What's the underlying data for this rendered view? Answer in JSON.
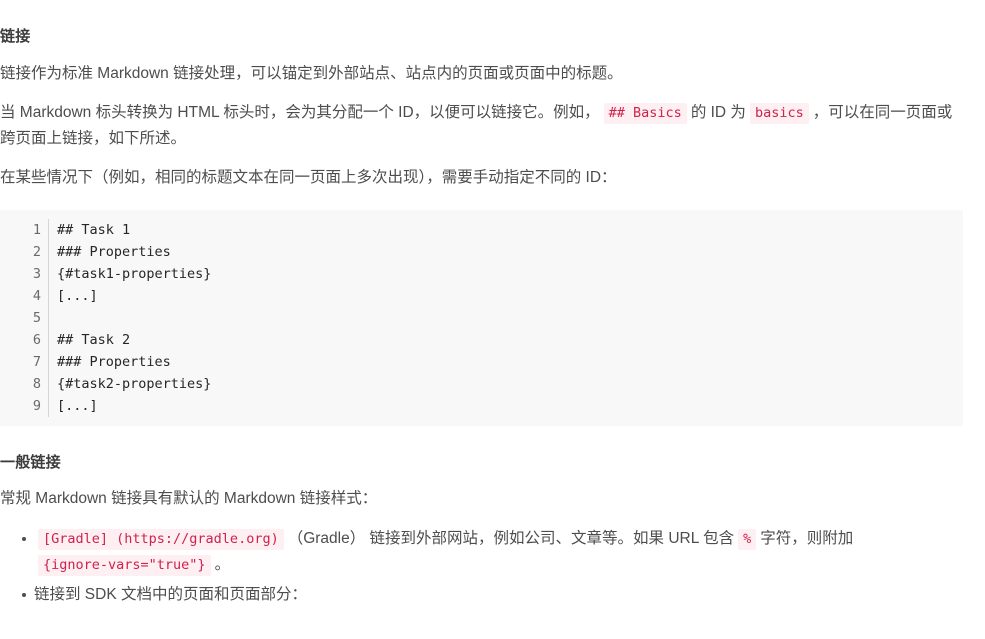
{
  "document": {
    "heading": "链接",
    "paragraphs": {
      "p1": "链接作为标准 Markdown 链接处理，可以锚定到外部站点、站点内的页面或页面中的标题。",
      "p2_part1": "当 Markdown 标头转换为 HTML 标头时，会为其分配一个 ID，以便可以链接它。例如，",
      "p2_code1": "## Basics",
      "p2_part2": "的 ID 为",
      "p2_code2": "basics",
      "p2_part3": "，可以在同一页面或跨页面上链接，如下所述。",
      "p3": "在某些情况下（例如，相同的标题文本在同一页面上多次出现），需要手动指定不同的 ID："
    },
    "codeblock": {
      "lines": [
        {
          "number": "1",
          "text": "## Task 1"
        },
        {
          "number": "2",
          "text": "### Properties"
        },
        {
          "number": "3",
          "text": "{#task1-properties}"
        },
        {
          "number": "4",
          "text": "[...]"
        },
        {
          "number": "5",
          "text": ""
        },
        {
          "number": "6",
          "text": "## Task 2"
        },
        {
          "number": "7",
          "text": "### Properties"
        },
        {
          "number": "8",
          "text": "{#task2-properties}"
        },
        {
          "number": "9",
          "text": "[...]"
        }
      ]
    },
    "subsection": {
      "heading": "一般链接",
      "intro": "常规 Markdown 链接具有默认的 Markdown 链接样式：",
      "bullets": {
        "b1_code1": "[Gradle] (https://gradle.org)",
        "b1_part1": "（Gradle） 链接到外部网站，例如公司、文章等。如果 URL 包含",
        "b1_code2": "%",
        "b1_part2": "字符，则附加",
        "b1_code3": "{ignore-vars=\"true\"}",
        "b1_part3": "。",
        "b2": "链接到 SDK 文档中的页面和页面部分："
      }
    }
  },
  "colors": {
    "text": "#4d4d4d",
    "heading": "#3c3c3c",
    "inline_code_text": "#d0224b",
    "inline_code_bg": "#fdeff2",
    "codeblock_bg": "#f8f8f8",
    "gutter_text": "#6a6a6a",
    "code_text": "#262626",
    "rule": "#d6d6d6"
  }
}
